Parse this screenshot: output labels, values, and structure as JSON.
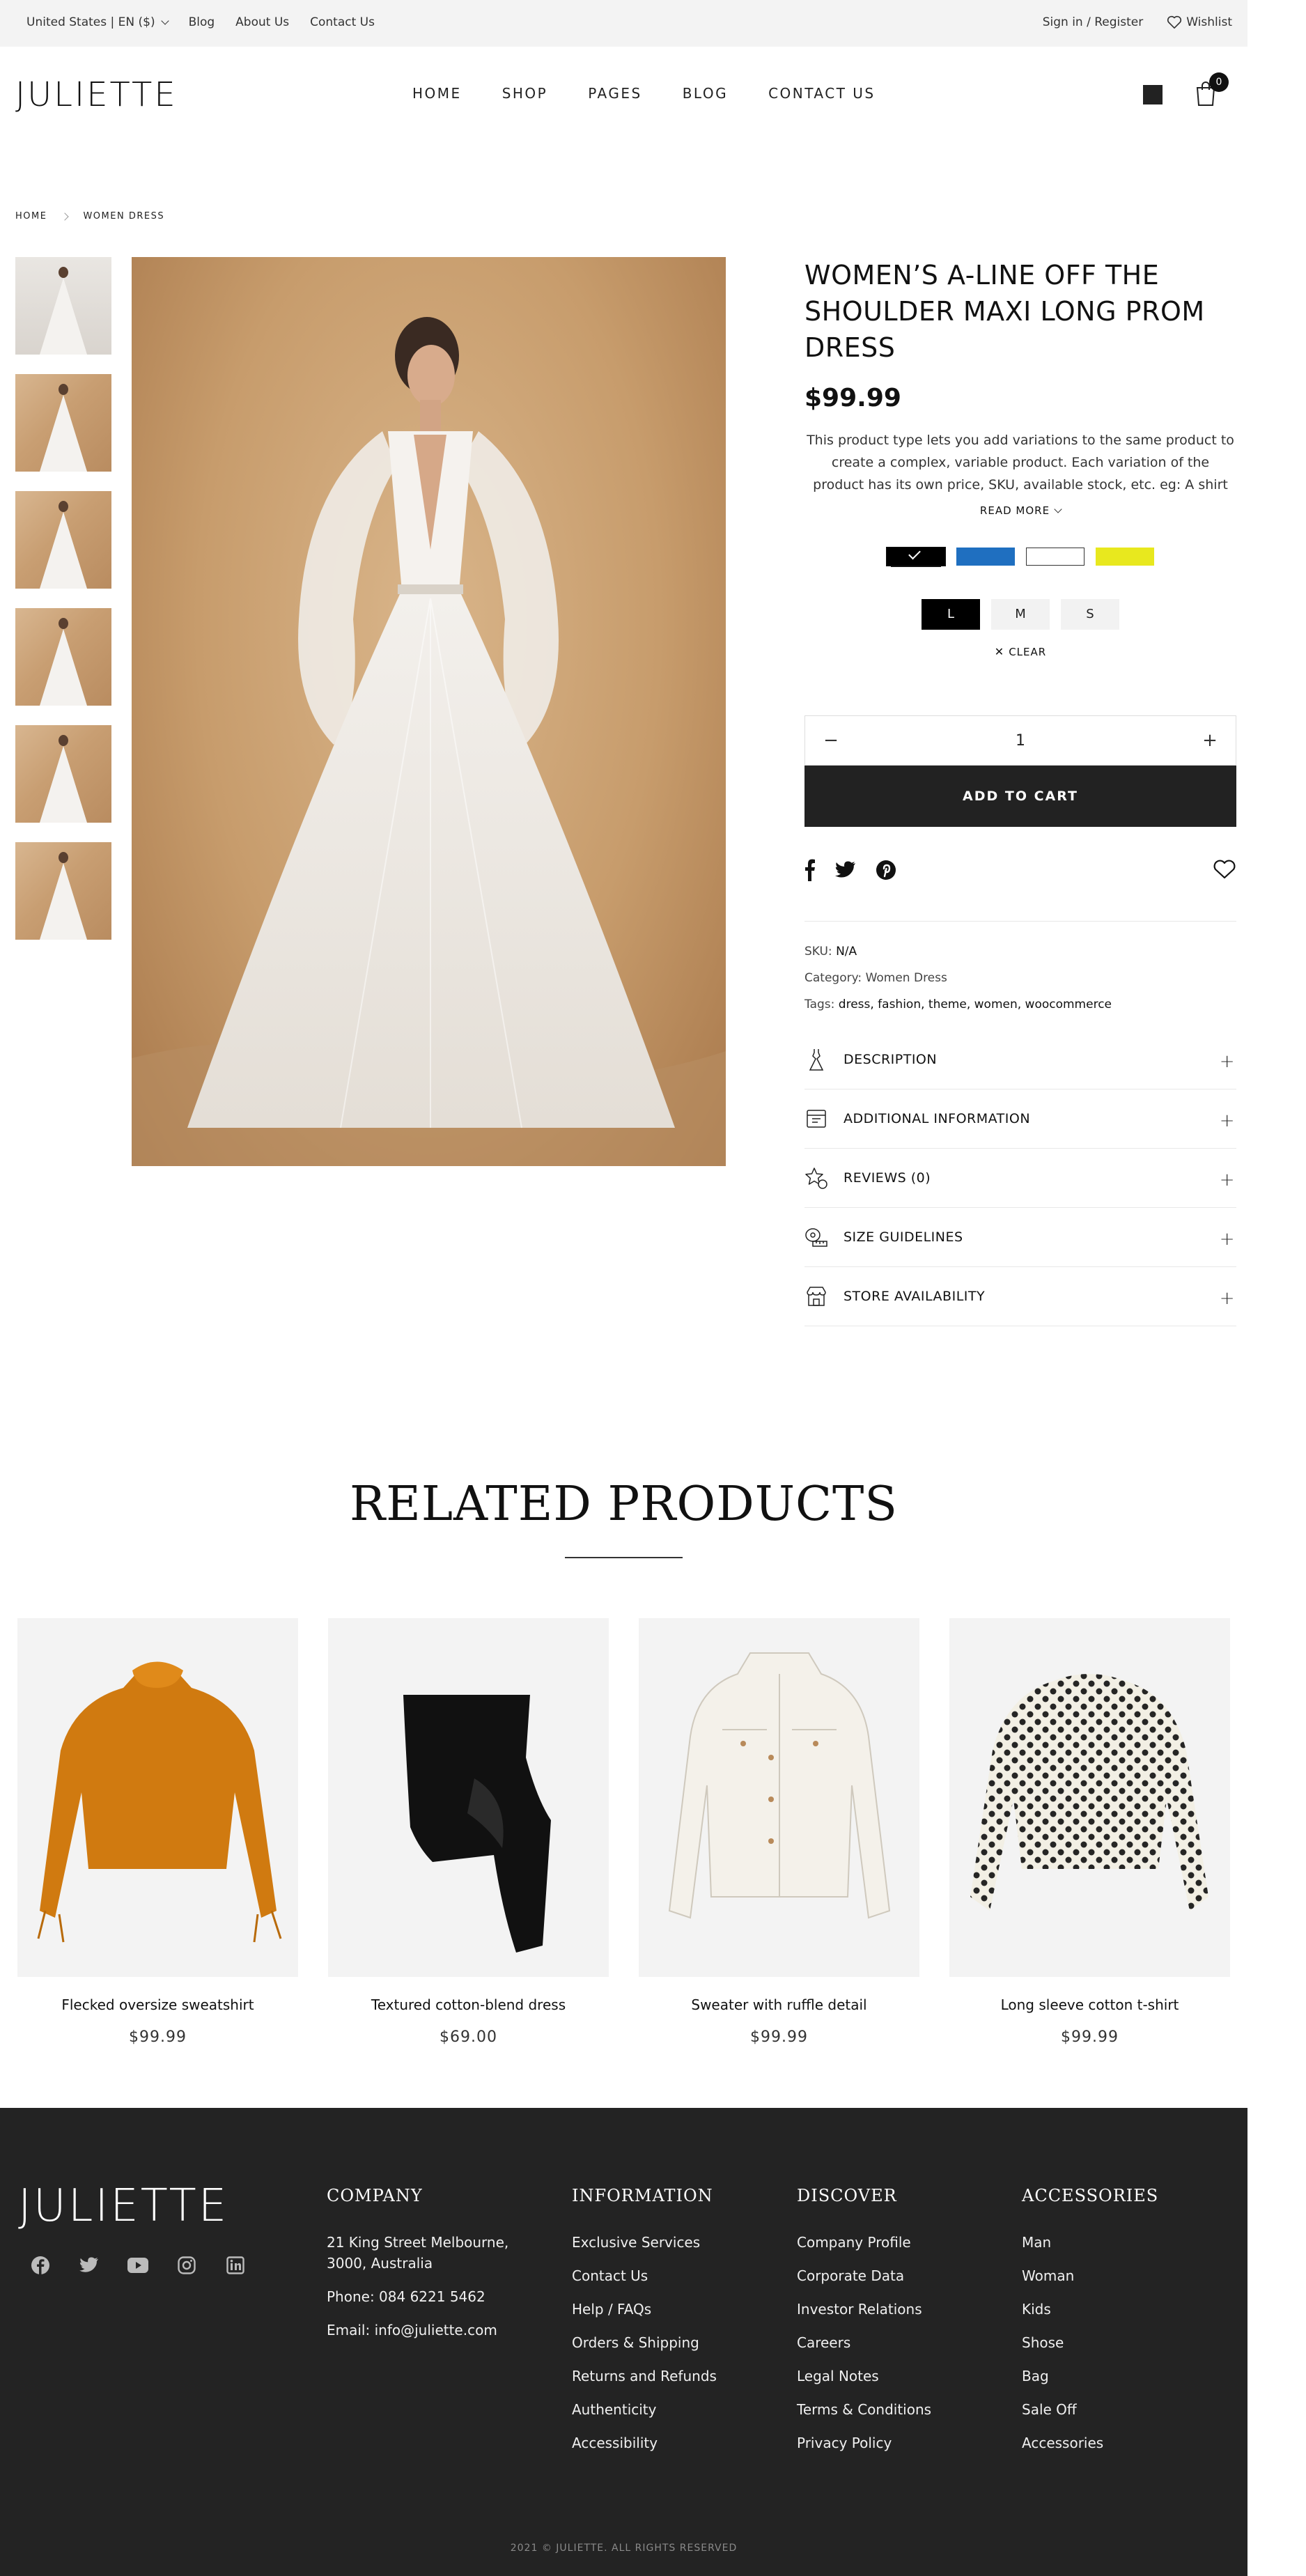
{
  "topbar": {
    "locale": "United States | EN ($)",
    "links": [
      "Blog",
      "About Us",
      "Contact Us"
    ],
    "signin": "Sign in / Register",
    "wishlist": "Wishlist"
  },
  "header": {
    "logo": "JULIETTE",
    "nav": [
      "HOME",
      "SHOP",
      "PAGES",
      "BLOG",
      "CONTACT US"
    ],
    "cart_count": "0"
  },
  "breadcrumb": {
    "home": "HOME",
    "current": "WOMEN DRESS"
  },
  "product": {
    "title": "WOMEN’S A-LINE OFF THE SHOULDER MAXI LONG PROM DRESS",
    "price": "$99.99",
    "description": "This product type lets you add variations to the same product to create a complex, variable product. Each variation of the product has its own price, SKU, available stock, etc. eg: A shirt",
    "read_more": "READ MORE",
    "colors": [
      "#000000",
      "#1f6fc0",
      "#ffffff",
      "#e8e81e"
    ],
    "sizes": [
      "L",
      "M",
      "S"
    ],
    "clear": "CLEAR",
    "quantity": "1",
    "add_to_cart": "ADD TO CART",
    "sku_label": "SKU:",
    "sku": "N/A",
    "category_label": "Category:",
    "category": "Women Dress",
    "tags_label": "Tags:",
    "tags": "dress, fashion, theme, women, woocommerce",
    "accordion": [
      {
        "label": "DESCRIPTION",
        "icon": "dress-icon"
      },
      {
        "label": "ADDITIONAL INFORMATION",
        "icon": "info-box-icon"
      },
      {
        "label": "REVIEWS (0)",
        "icon": "star-review-icon"
      },
      {
        "label": "SIZE GUIDELINES",
        "icon": "measuring-tape-icon"
      },
      {
        "label": "STORE AVAILABILITY",
        "icon": "store-icon"
      }
    ]
  },
  "related": {
    "heading": "RELATED PRODUCTS",
    "items": [
      {
        "name": "Flecked oversize sweatshirt",
        "price": "$99.99",
        "color": "#d07a10"
      },
      {
        "name": "Textured cotton-blend dress",
        "price": "$69.00",
        "color": "#111111"
      },
      {
        "name": "Sweater with ruffle detail",
        "price": "$99.99",
        "color": "#f4f1ea"
      },
      {
        "name": "Long sleeve cotton t-shirt",
        "price": "$99.99",
        "color": "#f2efe4"
      }
    ]
  },
  "footer": {
    "logo": "JULIETTE",
    "company": {
      "heading": "COMPANY",
      "address": "21 King Street Melbourne, 3000, Australia",
      "phone": "Phone: 084 6221 5462",
      "email": "Email: info@juliette.com"
    },
    "information": {
      "heading": "INFORMATION",
      "items": [
        "Exclusive Services",
        "Contact Us",
        "Help / FAQs",
        "Orders & Shipping",
        "Returns and Refunds",
        "Authenticity",
        "Accessibility"
      ]
    },
    "discover": {
      "heading": "DISCOVER",
      "items": [
        "Company Profile",
        "Corporate Data",
        "Investor Relations",
        "Careers",
        "Legal Notes",
        "Terms & Conditions",
        "Privacy Policy"
      ]
    },
    "accessories": {
      "heading": "ACCESSORIES",
      "items": [
        "Man",
        "Woman",
        "Kids",
        "Shose",
        "Bag",
        "Sale Off",
        "Accessories"
      ]
    },
    "copyright": "2021 © JULIETTE. ALL RIGHTS RESERVED"
  }
}
